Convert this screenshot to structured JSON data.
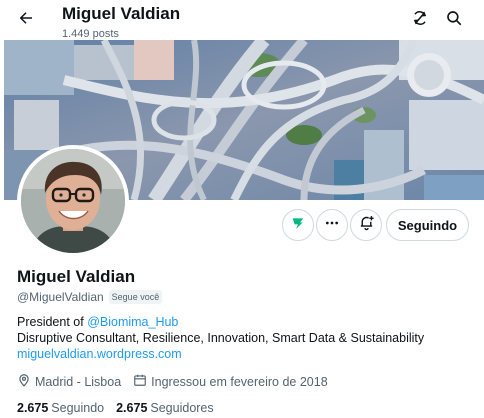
{
  "header": {
    "title": "Miguel Valdian",
    "post_count": "1.449 posts"
  },
  "icons": {
    "back": "arrow-left-icon",
    "refresh": "refresh-icon",
    "search": "search-icon",
    "grok": "grok-icon",
    "more": "more-icon",
    "notifications": "bell-plus-icon",
    "location": "location-pin-icon",
    "calendar": "calendar-icon"
  },
  "profile": {
    "name": "Miguel Valdian",
    "handle": "@MiguelValdian",
    "follows_you": "Segue você",
    "following_button": "Seguindo",
    "bio_prefix": "President of ",
    "bio_mention": "@Biomima_Hub",
    "bio_line2": "Disruptive Consultant, Resilience, Innovation, Smart Data & Sustainability",
    "website": "miguelvaldian.wordpress.com",
    "location": "Madrid - Lisboa",
    "joined": "Ingressou em fevereiro de 2018",
    "following_count": "2.675",
    "following_label": "Seguindo",
    "followers_count": "2.675",
    "followers_label": "Seguidores"
  },
  "colors": {
    "accent": "#1d9bf0",
    "text_primary": "#0f1419",
    "text_secondary": "#536471",
    "border": "#cfd9de",
    "grok_green": "#00ba7c"
  }
}
